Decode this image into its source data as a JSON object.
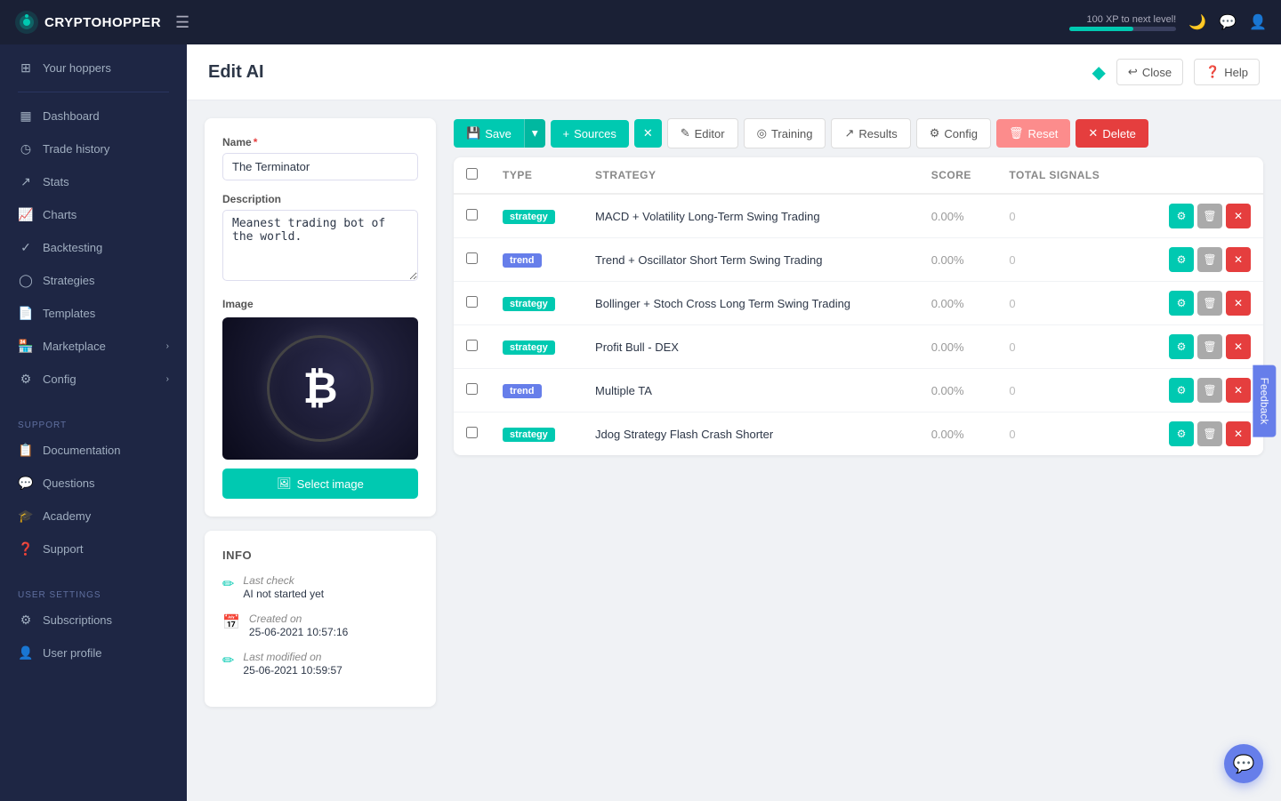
{
  "topnav": {
    "logo_text": "CRYPTOHOPPER",
    "xp_label": "100 XP to next level!",
    "xp_percent": 60
  },
  "sidebar": {
    "items": [
      {
        "id": "your-hoppers",
        "label": "Your hoppers",
        "icon": "⊞"
      },
      {
        "id": "dashboard",
        "label": "Dashboard",
        "icon": "⬛"
      },
      {
        "id": "trade-history",
        "label": "Trade history",
        "icon": "◷"
      },
      {
        "id": "stats",
        "label": "Stats",
        "icon": "↗"
      },
      {
        "id": "charts",
        "label": "Charts",
        "icon": "📊"
      },
      {
        "id": "backtesting",
        "label": "Backtesting",
        "icon": "✓"
      },
      {
        "id": "strategies",
        "label": "Strategies",
        "icon": "○"
      },
      {
        "id": "templates",
        "label": "Templates",
        "icon": "📄"
      },
      {
        "id": "marketplace",
        "label": "Marketplace",
        "icon": "🏪",
        "has_chevron": true
      },
      {
        "id": "config",
        "label": "Config",
        "icon": "⚙",
        "has_chevron": true
      }
    ],
    "support_section": "SUPPORT",
    "support_items": [
      {
        "id": "documentation",
        "label": "Documentation",
        "icon": "📋"
      },
      {
        "id": "questions",
        "label": "Questions",
        "icon": "💬"
      },
      {
        "id": "academy",
        "label": "Academy",
        "icon": "🎓"
      },
      {
        "id": "support",
        "label": "Support",
        "icon": "❓"
      }
    ],
    "user_settings_section": "USER SETTINGS",
    "user_settings_items": [
      {
        "id": "subscriptions",
        "label": "Subscriptions",
        "icon": "⚙"
      },
      {
        "id": "user-profile",
        "label": "User profile",
        "icon": "👤"
      }
    ]
  },
  "page": {
    "title": "Edit AI",
    "close_label": "Close",
    "help_label": "Help"
  },
  "left_panel": {
    "name_label": "Name",
    "name_required": "*",
    "name_value": "The Terminator",
    "description_label": "Description",
    "description_value": "Meanest trading bot of the world.",
    "image_label": "Image",
    "select_image_label": "Select image"
  },
  "info": {
    "section_label": "INFO",
    "last_check_label": "Last check",
    "last_check_value": "AI not started yet",
    "created_on_label": "Created on",
    "created_on_value": "25-06-2021 10:57:16",
    "last_modified_label": "Last modified on",
    "last_modified_value": "25-06-2021 10:59:57"
  },
  "toolbar": {
    "save_label": "Save",
    "sources_label": "Sources",
    "editor_label": "Editor",
    "training_label": "Training",
    "results_label": "Results",
    "config_label": "Config",
    "reset_label": "Reset",
    "delete_label": "Delete"
  },
  "table": {
    "headers": [
      "Type",
      "Strategy",
      "Score",
      "Total signals",
      ""
    ],
    "rows": [
      {
        "type": "strategy",
        "type_class": "badge-strategy",
        "strategy": "MACD + Volatility Long-Term Swing Trading",
        "score": "0.00%",
        "total_signals": "0"
      },
      {
        "type": "trend",
        "type_class": "badge-trend",
        "strategy": "Trend + Oscillator Short Term Swing Trading",
        "score": "0.00%",
        "total_signals": "0"
      },
      {
        "type": "strategy",
        "type_class": "badge-strategy",
        "strategy": "Bollinger + Stoch Cross Long Term Swing Trading",
        "score": "0.00%",
        "total_signals": "0"
      },
      {
        "type": "strategy",
        "type_class": "badge-strategy",
        "strategy": "Profit Bull - DEX",
        "score": "0.00%",
        "total_signals": "0"
      },
      {
        "type": "trend",
        "type_class": "badge-trend",
        "strategy": "Multiple TA",
        "score": "0.00%",
        "total_signals": "0"
      },
      {
        "type": "strategy",
        "type_class": "badge-strategy",
        "strategy": "Jdog Strategy Flash Crash Shorter",
        "score": "0.00%",
        "total_signals": "0"
      }
    ]
  },
  "feedback": {
    "label": "Feedback"
  }
}
